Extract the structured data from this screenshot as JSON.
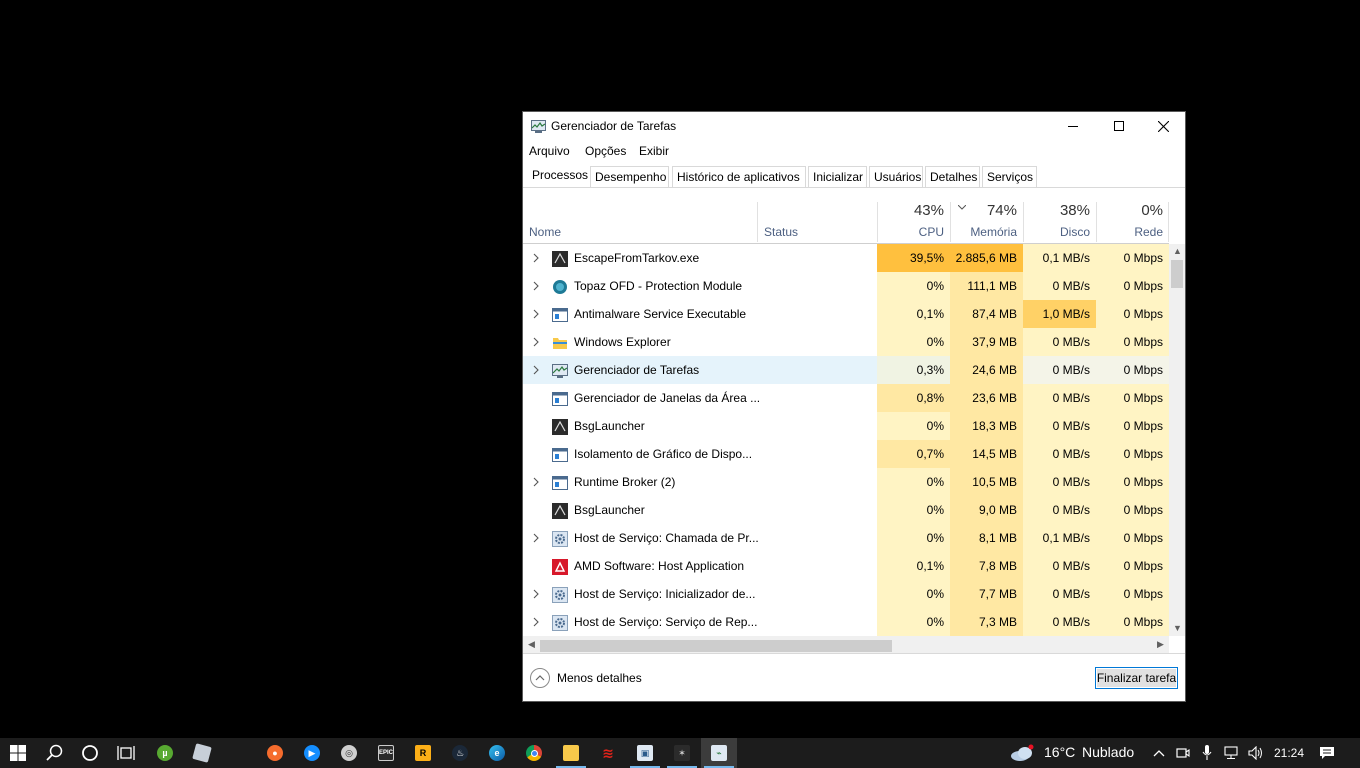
{
  "window": {
    "title": "Gerenciador de Tarefas",
    "menu": [
      "Arquivo",
      "Opções",
      "Exibir"
    ],
    "tabs": [
      "Processos",
      "Desempenho",
      "Histórico de aplicativos",
      "Inicializar",
      "Usuários",
      "Detalhes",
      "Serviços"
    ],
    "active_tab": "Processos"
  },
  "columns": {
    "name": "Nome",
    "status": "Status",
    "cpu": {
      "pct": "43%",
      "label": "CPU"
    },
    "memory": {
      "pct": "74%",
      "label": "Memória",
      "sorted": true
    },
    "disk": {
      "pct": "38%",
      "label": "Disco"
    },
    "network": {
      "pct": "0%",
      "label": "Rede"
    }
  },
  "processes": [
    {
      "name": "EscapeFromTarkov.exe",
      "icon": "tarkov-icon",
      "expandable": true,
      "cpu": "39,5%",
      "mem": "2.885,6 MB",
      "disk": "0,1 MB/s",
      "net": "0 Mbps"
    },
    {
      "name": "Topaz OFD - Protection Module",
      "icon": "topaz-icon",
      "expandable": true,
      "cpu": "0%",
      "mem": "111,1 MB",
      "disk": "0 MB/s",
      "net": "0 Mbps"
    },
    {
      "name": "Antimalware Service Executable",
      "icon": "window-app-icon",
      "expandable": true,
      "cpu": "0,1%",
      "mem": "87,4 MB",
      "disk": "1,0 MB/s",
      "net": "0 Mbps"
    },
    {
      "name": "Windows Explorer",
      "icon": "folder-icon",
      "expandable": true,
      "cpu": "0%",
      "mem": "37,9 MB",
      "disk": "0 MB/s",
      "net": "0 Mbps"
    },
    {
      "name": "Gerenciador de Tarefas",
      "icon": "task-manager-icon",
      "expandable": true,
      "selected": true,
      "cpu": "0,3%",
      "mem": "24,6 MB",
      "disk": "0 MB/s",
      "net": "0 Mbps"
    },
    {
      "name": "Gerenciador de Janelas da Área ...",
      "icon": "window-app-icon",
      "expandable": false,
      "cpu": "0,8%",
      "mem": "23,6 MB",
      "disk": "0 MB/s",
      "net": "0 Mbps"
    },
    {
      "name": "BsgLauncher",
      "icon": "tarkov-icon",
      "expandable": false,
      "cpu": "0%",
      "mem": "18,3 MB",
      "disk": "0 MB/s",
      "net": "0 Mbps"
    },
    {
      "name": "Isolamento de Gráfico de Dispo...",
      "icon": "window-app-icon",
      "expandable": false,
      "cpu": "0,7%",
      "mem": "14,5 MB",
      "disk": "0 MB/s",
      "net": "0 Mbps"
    },
    {
      "name": "Runtime Broker (2)",
      "icon": "window-app-icon",
      "expandable": true,
      "cpu": "0%",
      "mem": "10,5 MB",
      "disk": "0 MB/s",
      "net": "0 Mbps"
    },
    {
      "name": "BsgLauncher",
      "icon": "tarkov-icon",
      "expandable": false,
      "cpu": "0%",
      "mem": "9,0 MB",
      "disk": "0 MB/s",
      "net": "0 Mbps"
    },
    {
      "name": "Host de Serviço: Chamada de Pr...",
      "icon": "gear-icon",
      "expandable": true,
      "cpu": "0%",
      "mem": "8,1 MB",
      "disk": "0,1 MB/s",
      "net": "0 Mbps"
    },
    {
      "name": "AMD Software: Host Application",
      "icon": "amd-icon",
      "expandable": false,
      "cpu": "0,1%",
      "mem": "7,8 MB",
      "disk": "0 MB/s",
      "net": "0 Mbps"
    },
    {
      "name": "Host de Serviço: Inicializador de...",
      "icon": "gear-icon",
      "expandable": true,
      "cpu": "0%",
      "mem": "7,7 MB",
      "disk": "0 MB/s",
      "net": "0 Mbps"
    },
    {
      "name": "Host de Serviço: Serviço de Rep...",
      "icon": "gear-icon",
      "expandable": true,
      "cpu": "0%",
      "mem": "7,3 MB",
      "disk": "0 MB/s",
      "net": "0 Mbps"
    }
  ],
  "footer": {
    "less_details": "Menos detalhes",
    "end_task": "Finalizar tarefa"
  },
  "taskbar": {
    "weather": {
      "temp": "16°C",
      "condition": "Nublado"
    },
    "time": "21:24"
  },
  "colors": {
    "heat_low": "#fff4c4",
    "heat_mid": "#ffe8a3",
    "heat_high": "#ffd166",
    "heat_hot": "#ffc03e",
    "selected_row": "#e5f3fb"
  }
}
